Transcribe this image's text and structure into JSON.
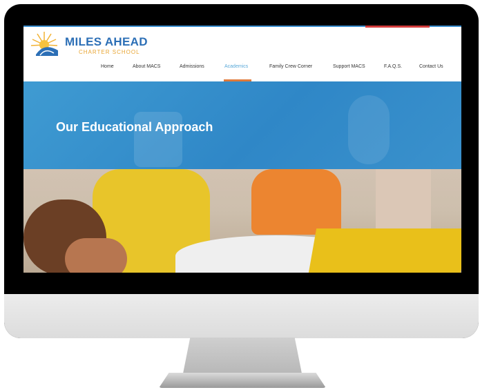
{
  "logo": {
    "name": "MILES AHEAD",
    "subtitle": "CHARTER SCHOOL"
  },
  "nav": {
    "items": [
      {
        "label": "Home"
      },
      {
        "label": "About MACS"
      },
      {
        "label": "Admissions"
      },
      {
        "label": "Academics",
        "active": true
      },
      {
        "label": "Family Crew Corner"
      },
      {
        "label": "Support MACS"
      },
      {
        "label": "F.A.Q.S."
      },
      {
        "label": "Contact Us"
      }
    ]
  },
  "hero": {
    "title": "Our Educational Approach"
  },
  "colors": {
    "brand_blue": "#2f87c7",
    "accent_orange": "#e07a3a",
    "active_link": "#58a8d8",
    "top_red": "#d23b3b"
  }
}
